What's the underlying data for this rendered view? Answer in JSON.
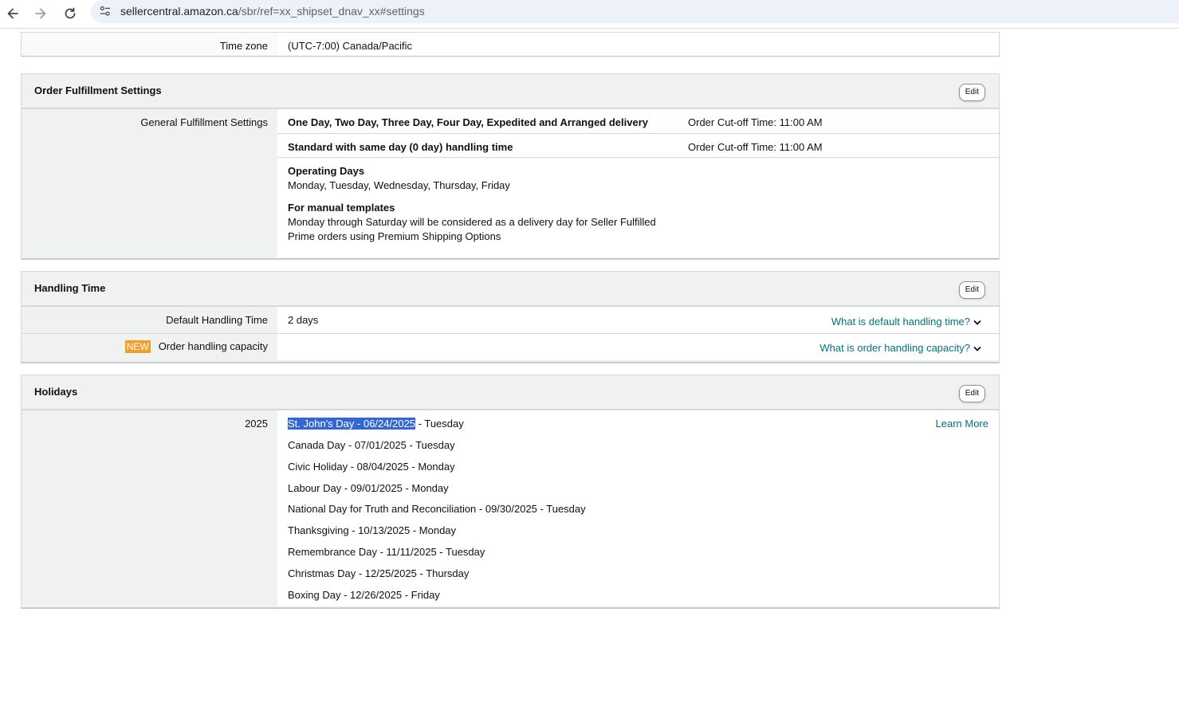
{
  "browser": {
    "url_host": "sellercentral.amazon.ca",
    "url_path": "/sbr/ref=xx_shipset_dnav_xx#settings"
  },
  "timezone": {
    "label": "Time zone",
    "value": "(UTC-7:00) Canada/Pacific"
  },
  "order_fulfillment": {
    "title": "Order Fulfillment Settings",
    "edit_label": "Edit",
    "general_label": "General Fulfillment Settings",
    "rows": [
      {
        "name": "One Day, Two Day, Three Day, Four Day, Expedited and Arranged delivery",
        "cutoff": "Order Cut-off Time: 11:00 AM"
      },
      {
        "name": "Standard with same day (0 day) handling time",
        "cutoff": "Order Cut-off Time: 11:00 AM"
      }
    ],
    "operating_days_heading": "Operating Days",
    "operating_days_value": "Monday, Tuesday, Wednesday, Thursday, Friday",
    "manual_templates_heading": "For manual templates",
    "manual_templates_line1": "Monday through Saturday will be considered as a delivery day for Seller Fulfilled",
    "manual_templates_line2": "Prime orders using Premium Shipping Options"
  },
  "handling_time": {
    "title": "Handling Time",
    "edit_label": "Edit",
    "default_label": "Default Handling Time",
    "default_value": "2 days",
    "default_help": "What is default handling time?",
    "capacity_badge": "NEW",
    "capacity_label": "Order handling capacity",
    "capacity_help": "What is order handling capacity?"
  },
  "holidays": {
    "title": "Holidays",
    "edit_label": "Edit",
    "year": "2025",
    "learn_more": "Learn More",
    "items": [
      {
        "name": "St. John's Day - 06/24/2025",
        "day": "-  Tuesday"
      },
      {
        "name": "Canada Day - 07/01/2025",
        "day": "-  Tuesday"
      },
      {
        "name": "Civic Holiday - 08/04/2025",
        "day": "-  Monday"
      },
      {
        "name": "Labour Day - 09/01/2025",
        "day": "-  Monday"
      },
      {
        "name": "National Day for Truth and Reconciliation - 09/30/2025",
        "day": "-  Tuesday"
      },
      {
        "name": "Thanksgiving - 10/13/2025",
        "day": "-  Monday"
      },
      {
        "name": "Remembrance Day - 11/11/2025",
        "day": "-  Tuesday"
      },
      {
        "name": "Christmas Day - 12/25/2025",
        "day": "-  Thursday"
      },
      {
        "name": "Boxing Day - 12/26/2025",
        "day": "-  Friday"
      }
    ]
  }
}
